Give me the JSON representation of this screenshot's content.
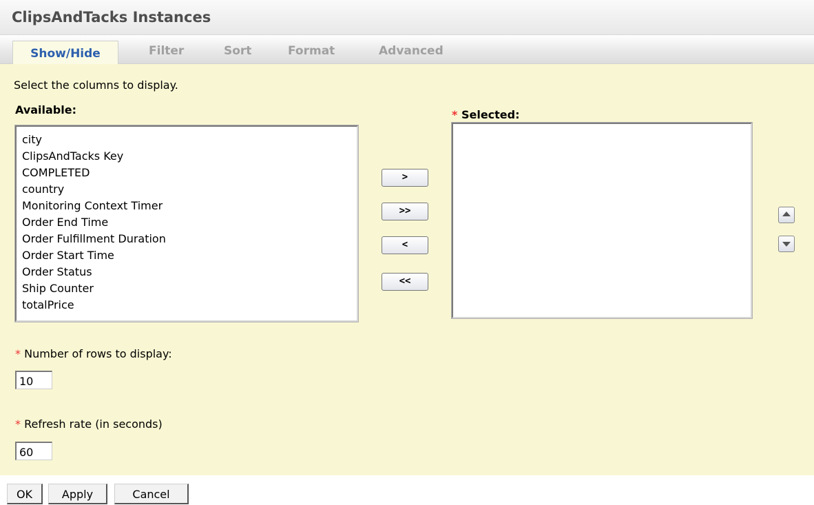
{
  "header": {
    "title": "ClipsAndTacks Instances"
  },
  "tabs": [
    {
      "label": "Show/Hide"
    },
    {
      "label": "Filter"
    },
    {
      "label": "Sort"
    },
    {
      "label": "Format"
    },
    {
      "label": "Advanced"
    }
  ],
  "panel": {
    "instructions": "Select the columns to display.",
    "available_label": "Available:",
    "selected_label": "Selected:",
    "required_mark": "*",
    "available_items": [
      "city",
      "ClipsAndTacks Key",
      "COMPLETED",
      "country",
      "Monitoring Context Timer",
      "Order End Time",
      "Order Fulfillment Duration",
      "Order Start Time",
      "Order Status",
      "Ship Counter",
      "totalPrice"
    ],
    "move_buttons": {
      "add": ">",
      "add_all": ">>",
      "remove": "<",
      "remove_all": "<<"
    },
    "rows_label": "Number of rows to display:",
    "rows_value": "10",
    "refresh_label": "Refresh rate (in seconds)",
    "refresh_value": "60"
  },
  "footer": {
    "ok": "OK",
    "apply": "Apply",
    "cancel": "Cancel"
  }
}
